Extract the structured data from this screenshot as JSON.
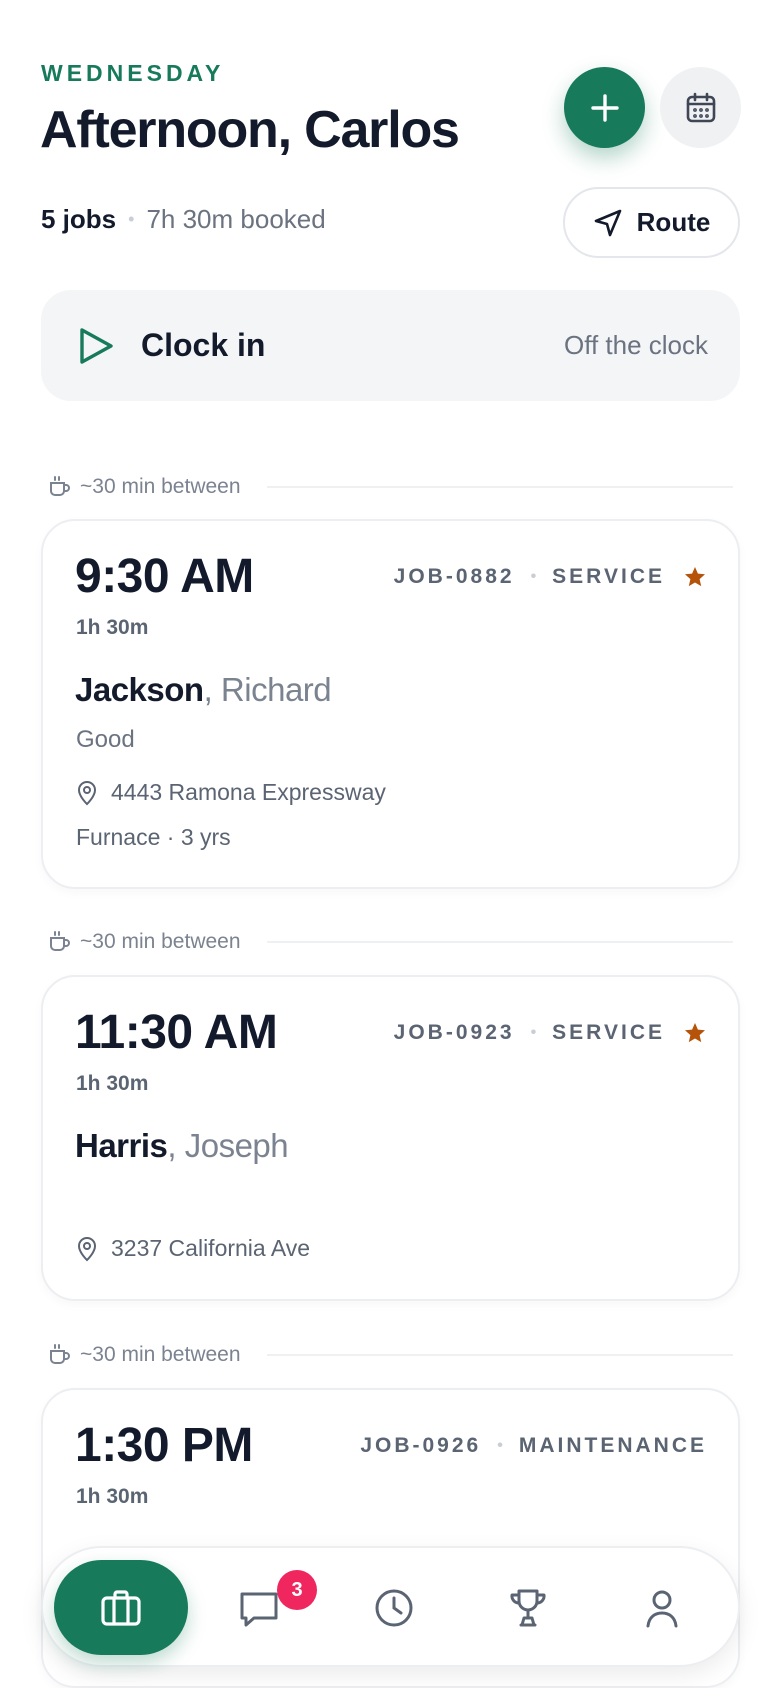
{
  "header": {
    "day": "WEDNESDAY",
    "greeting": "Afternoon, Carlos",
    "jobs_count": "5 jobs",
    "booked": "7h 30m booked",
    "route_label": "Route"
  },
  "clock": {
    "label": "Clock in",
    "status": "Off the clock"
  },
  "gaps": [
    "~30 min between",
    "~30 min between",
    "~30 min between"
  ],
  "jobs": [
    {
      "time": "9:30 AM",
      "duration": "1h 30m",
      "job_id": "JOB-0882",
      "type": "SERVICE",
      "starred": true,
      "last_name": "Jackson",
      "first_name": ", Richard",
      "rating": "Good",
      "address": "4443 Ramona Expressway",
      "equipment": "Furnace · 3 yrs"
    },
    {
      "time": "11:30 AM",
      "duration": "1h 30m",
      "job_id": "JOB-0923",
      "type": "SERVICE",
      "starred": true,
      "last_name": "Harris",
      "first_name": ", Joseph",
      "address": "3237 California Ave"
    },
    {
      "time": "1:30 PM",
      "duration": "1h 30m",
      "job_id": "JOB-0926",
      "type": "MAINTENANCE",
      "starred": false
    }
  ],
  "nav": {
    "items": [
      "jobs-icon",
      "messages-icon",
      "clock-icon",
      "trophy-icon",
      "profile-icon"
    ],
    "messages_badge": "3"
  },
  "colors": {
    "accent": "#177a5b",
    "star": "#b45309",
    "badge": "#f0265f"
  }
}
